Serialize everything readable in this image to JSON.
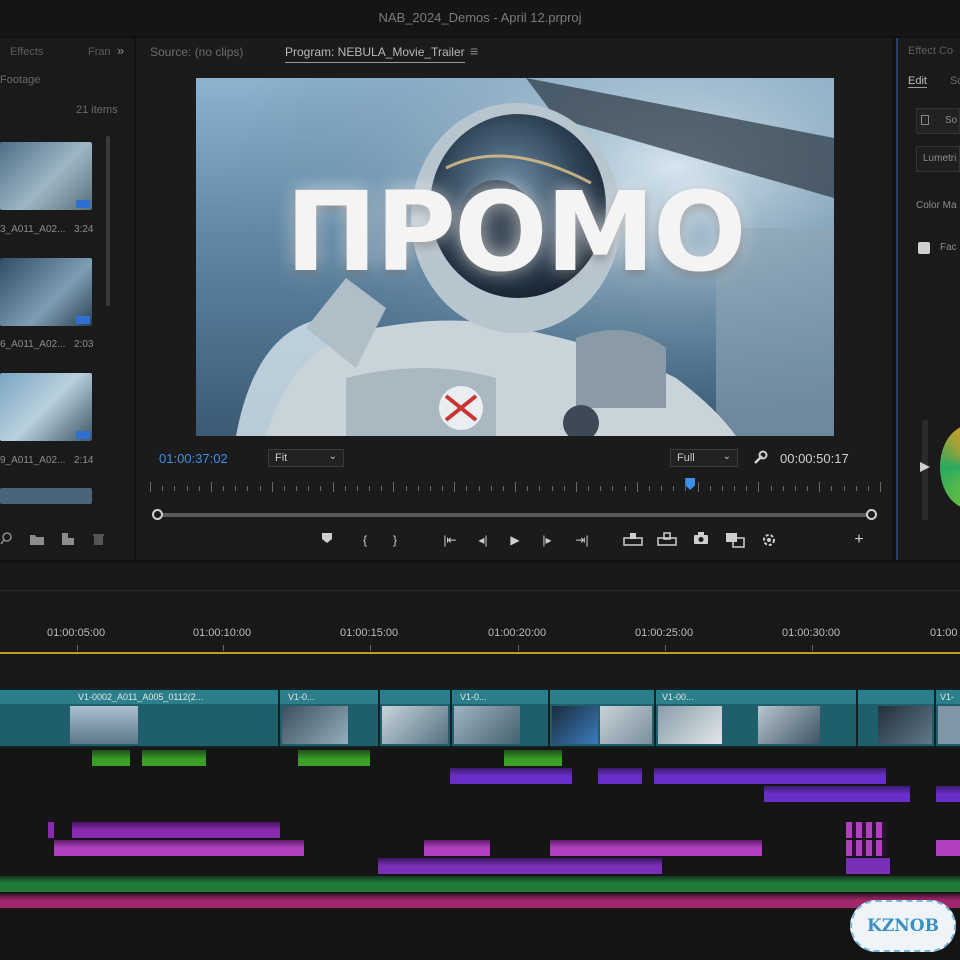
{
  "app": {
    "title": "NAB_2024_Demos - April 12.prproj"
  },
  "project_panel": {
    "tab_effects": "Effects",
    "tab_frame": "Fran",
    "chevron": "»",
    "folder_label": "Footage",
    "items_count": "21 items",
    "items": [
      {
        "name": "3_A011_A02...",
        "duration": "3:24"
      },
      {
        "name": "6_A011_A02...",
        "duration": "2:03"
      },
      {
        "name": "9_A011_A02...",
        "duration": "2:14"
      }
    ]
  },
  "monitor": {
    "source_tab": "Source: (no clips)",
    "program_tab": "Program: NEBULA_Movie_Trailer",
    "menu_glyph": "≡",
    "overlay_title": "ПРОМО",
    "current_timecode": "01:00:37:02",
    "fit_label": "Fit",
    "quality_label": "Full",
    "duration_timecode": "00:00:50:17",
    "playhead_fraction": 0.74
  },
  "effects_panel": {
    "title": "Effect Co",
    "tab_edit": "Edit",
    "tab_other": "Sc",
    "item_so": "So",
    "item_lumetri": "Lumetri",
    "item_color": "Color Ma",
    "item_fac": "Fac"
  },
  "timeline": {
    "ruler": [
      "01:00:05:00",
      "01:00:10:00",
      "01:00:15:00",
      "01:00:20:00",
      "01:00:25:00",
      "01:00:30:00",
      "01:00"
    ],
    "clips": [
      "V1-0002_A011_A005_0112(2...",
      "V1-0...",
      "V1-0...",
      "V1-00...",
      "V1-"
    ]
  },
  "watermark": "KZNOB"
}
